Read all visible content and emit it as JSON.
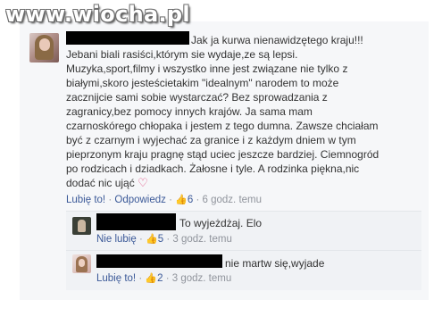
{
  "watermark": "www.wiocha.pl",
  "main_comment": {
    "author_visible_fragment": "",
    "first_line": "Jak ja kurwa nienawidzętego kraju!!!",
    "body": "Jebani biali rasiści,którym sie wydaje,ze są lepsi.\nMuzyka,sport,filmy i wszystko inne jest związane nie tylko z\nbiałymi,skoro jesteścietakim \"idealnym\" narodem to może\nzacznijcie sami sobie wystarczać? Bez sprowadzania z\nzagranicy,bez pomocy innych krajów. Ja sama mam\nczarnoskórego chłopaka i jestem z tego dumna. Zawsze chciałam\nbyć z czarnym i wyjechać za granice i z każdym dniem w tym\npieprzonym kraju pragnę stąd uciec jeszcze bardziej. Ciemnogród\npo rodzicach i dziadkach. Żałosne i tyle. A rodzinka piękna,nic\ndodać nic ująć",
    "heart_icon": "heart-icon",
    "actions": {
      "like": "Lubię to!",
      "reply": "Odpowiedz",
      "like_count": "6",
      "time": "6 godz. temu"
    }
  },
  "replies": [
    {
      "text": "To wyjeżdżaj. Elo",
      "actions": {
        "like": "Nie lubię",
        "like_count": "5",
        "time": "3 godz. temu"
      }
    },
    {
      "text": "nie martw się,wyjade",
      "actions": {
        "like": "Lubię to!",
        "like_count": "2",
        "time": "3 godz. temu"
      }
    }
  ],
  "separator": "·",
  "thumb_icon": "thumbs-up-icon",
  "colors": {
    "link": "#3b5998",
    "meta": "#90949c",
    "heart": "#e0457b",
    "panel": "#f6f7f9"
  }
}
